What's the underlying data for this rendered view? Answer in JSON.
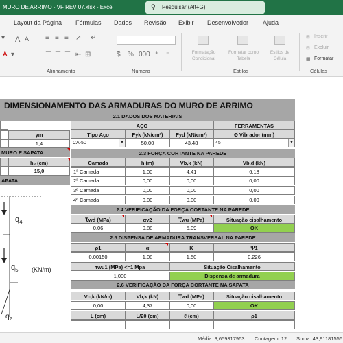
{
  "window": {
    "file_title": "MURO DE ARRIMO - VF REV 07.xlsx  -  Excel"
  },
  "search": {
    "placeholder": "Pesquisar (Alt+G)"
  },
  "tabs": [
    "Layout da Página",
    "Fórmulas",
    "Dados",
    "Revisão",
    "Exibir",
    "Desenvolvedor",
    "Ajuda"
  ],
  "ribbon": {
    "groups": {
      "alignment": "Alinhamento",
      "number": "Número",
      "styles": "Estilos",
      "cells": "Células"
    },
    "styles": {
      "conditional_1": "Formatação",
      "conditional_2": "Condicional",
      "table_1": "Formatar como",
      "table_2": "Tabela",
      "cell_1": "Estilos de",
      "cell_2": "Célula"
    },
    "cells": {
      "insert": "Inserir",
      "delete": "Excluir",
      "format": "Formatar"
    }
  },
  "sheet": {
    "title": "DIMENSIONAMENTO DAS ARMADURAS DO MURO DE ARRIMO",
    "materials": {
      "section": "2.1 DADOS DOS MATERIAIS",
      "gamma_header": "γm",
      "gamma_value": "1,4",
      "steel_band": "AÇO",
      "tools_band": "FERRAMENTAS",
      "steel_type_header": "Tipo Aço",
      "fyk_header": "Fyk (kN/cm²)",
      "fyd_header": "Fyd (kN/cm²)",
      "vibrator_header": "Ø Vibrador (mm)",
      "steel_type_value": "CA-50",
      "fyk_value": "50,00",
      "fyd_value": "43,48",
      "vibrator_value": "45"
    },
    "wall": {
      "section": "MURO E SAPATA",
      "h0_header": "h₀ (cm)",
      "h0_value": "15,0",
      "footing_section": "APATA"
    },
    "shear_wall": {
      "section": "2.3 FORÇA CORTANTE NA PAREDE",
      "headers": [
        "Camada",
        "h (m)",
        "Vb,k (kN)",
        "Vb,d (kN)"
      ],
      "rows": [
        {
          "camada": "1ª Camada",
          "h": "1,00",
          "vbk": "4,41",
          "vbd": "6,18"
        },
        {
          "camada": "2ª Camada",
          "h": "0,00",
          "vbk": "0,00",
          "vbd": "0,00"
        },
        {
          "camada": "3ª Camada",
          "h": "0,00",
          "vbk": "0,00",
          "vbd": "0,00"
        },
        {
          "camada": "4ª Camada",
          "h": "0,00",
          "vbk": "0,00",
          "vbd": "0,00"
        }
      ]
    },
    "check_wall": {
      "section": "2.4 VERIFICAÇÃO DA FORÇA CORTANTE NA PAREDE",
      "headers": [
        "Ꚍwd (MPa)",
        "αv2",
        "Ꚍwu (MPa)",
        "Situação cisalhamento"
      ],
      "values": [
        "0,06",
        "0,88",
        "5,09",
        "OK"
      ]
    },
    "transverse": {
      "section": "2.5 DISPENSA DE ARMADURA TRANSVERSAL NA PAREDE",
      "headers": [
        "ρ1",
        "α",
        "K",
        "Ψ1"
      ],
      "values": [
        "0,00150",
        "1,08",
        "1,50",
        "0,226"
      ],
      "tau_header": "τwu1 (MPa) <=1 Mpa",
      "situation_header": "Situação Cisalhamento",
      "tau_value": "1,000",
      "situation_value": "Dispensa de armadura"
    },
    "check_footing": {
      "section": "2.6 VERIFICAÇÃO DA FORÇA CORTANTE NA SAPATA",
      "headers": [
        "Vc,k (kN/m)",
        "Vb,k (kN)",
        "Ꚍwd (MPa)",
        "Situação  cisalhamento"
      ],
      "values": [
        "0,00",
        "4,37",
        "0,00",
        "OK"
      ],
      "next_headers": [
        "L (cm)",
        "L/20 (cm)",
        "ℓ (cm)",
        "ρ1"
      ]
    },
    "diagram": {
      "label_q4": "q",
      "sub_q4": "4",
      "label_q5": "q",
      "sub_q5": "5",
      "unit": "(KN/m)",
      "label_q2": "q",
      "sub_q2": "2"
    }
  },
  "status_bar": {
    "media": "Média: 3,659317963",
    "contagem": "Contagem: 12",
    "soma": "Soma: 43,91181556"
  }
}
